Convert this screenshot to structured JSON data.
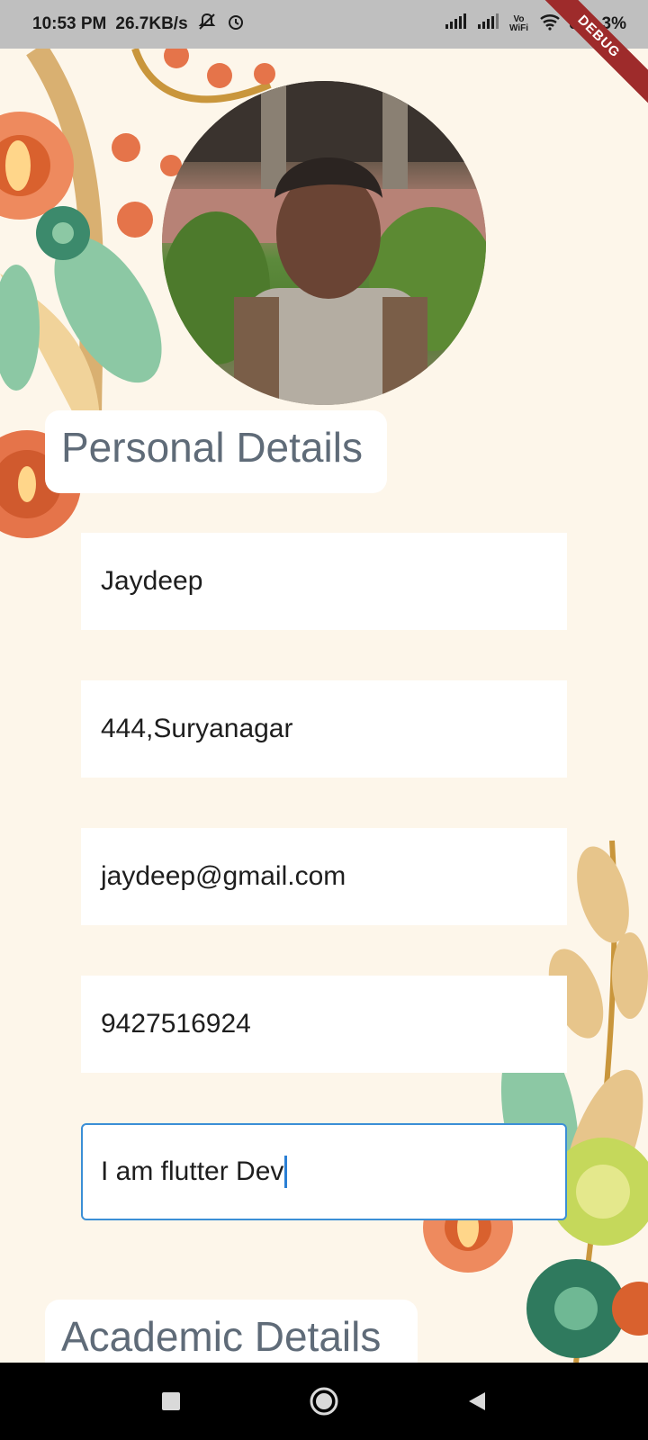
{
  "status_bar": {
    "time": "10:53 PM",
    "speed": "26.7KB/s",
    "battery": "3%",
    "icons": [
      "bell-off-icon",
      "alarm-icon",
      "signal-icon",
      "signal-icon",
      "vowifi-icon",
      "wifi-icon",
      "battery-icon"
    ],
    "vowifi_label": "Vo WiFi"
  },
  "debug_banner": "DEBUG",
  "profile": {
    "avatar": "profile-photo"
  },
  "personal": {
    "title": "Personal Details",
    "name": "Jaydeep",
    "address": "444,Suryanagar",
    "email": "jaydeep@gmail.com",
    "phone": "9427516924",
    "about": "I am flutter Dev"
  },
  "academic": {
    "title": "Academic Details"
  },
  "nav": {
    "icons": [
      "recents-icon",
      "home-icon",
      "back-icon"
    ]
  },
  "colors": {
    "background": "#fdf6ea",
    "title_text": "#5f6b78",
    "focus_border": "#3b8fd6"
  }
}
